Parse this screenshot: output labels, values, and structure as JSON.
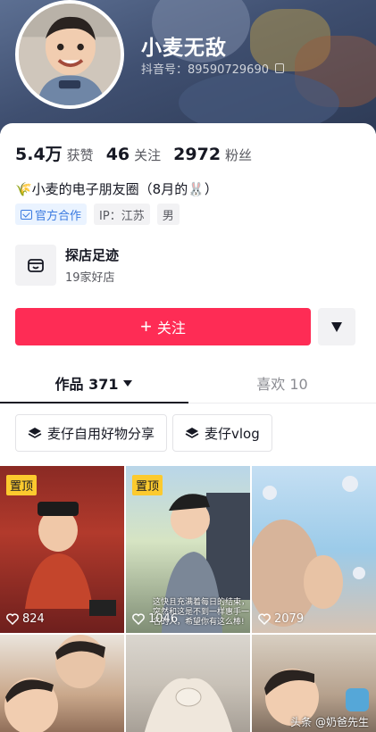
{
  "profile": {
    "nickname": "小麦无敌",
    "douyin_id": "抖音号：89590729690"
  },
  "stats": [
    {
      "value": "5.4万",
      "label": "获赞"
    },
    {
      "value": "46",
      "label": "关注"
    },
    {
      "value": "2972",
      "label": "粉丝"
    }
  ],
  "bio": "🌾小麦的电子朋友圈（8月的🐰）",
  "tags": [
    "官方合作",
    "IP：江苏",
    "男"
  ],
  "shop": {
    "title": "探店足迹",
    "subtitle": "19家好店"
  },
  "actions": {
    "follow_label": "关注",
    "follow_plus": "+"
  },
  "tabs": [
    {
      "label": "作品 371"
    },
    {
      "label": "喜欢 10"
    }
  ],
  "collections": [
    "麦仔自用好物分享",
    "麦仔vlog"
  ],
  "videos": [
    {
      "pinned": "置顶",
      "likes": "824"
    },
    {
      "pinned": "置顶",
      "likes": "1046",
      "overlay": "这快且充满着每日的结束，突然和这是不到一样惠手一名的人，希望你有这么棒!"
    },
    {
      "likes": "2079"
    },
    {},
    {},
    {}
  ],
  "watermark": "头条 @奶爸先生",
  "colors": {
    "accent": "#fe2c55",
    "pin": "#fcca2e",
    "official": "#3a7ae0"
  }
}
